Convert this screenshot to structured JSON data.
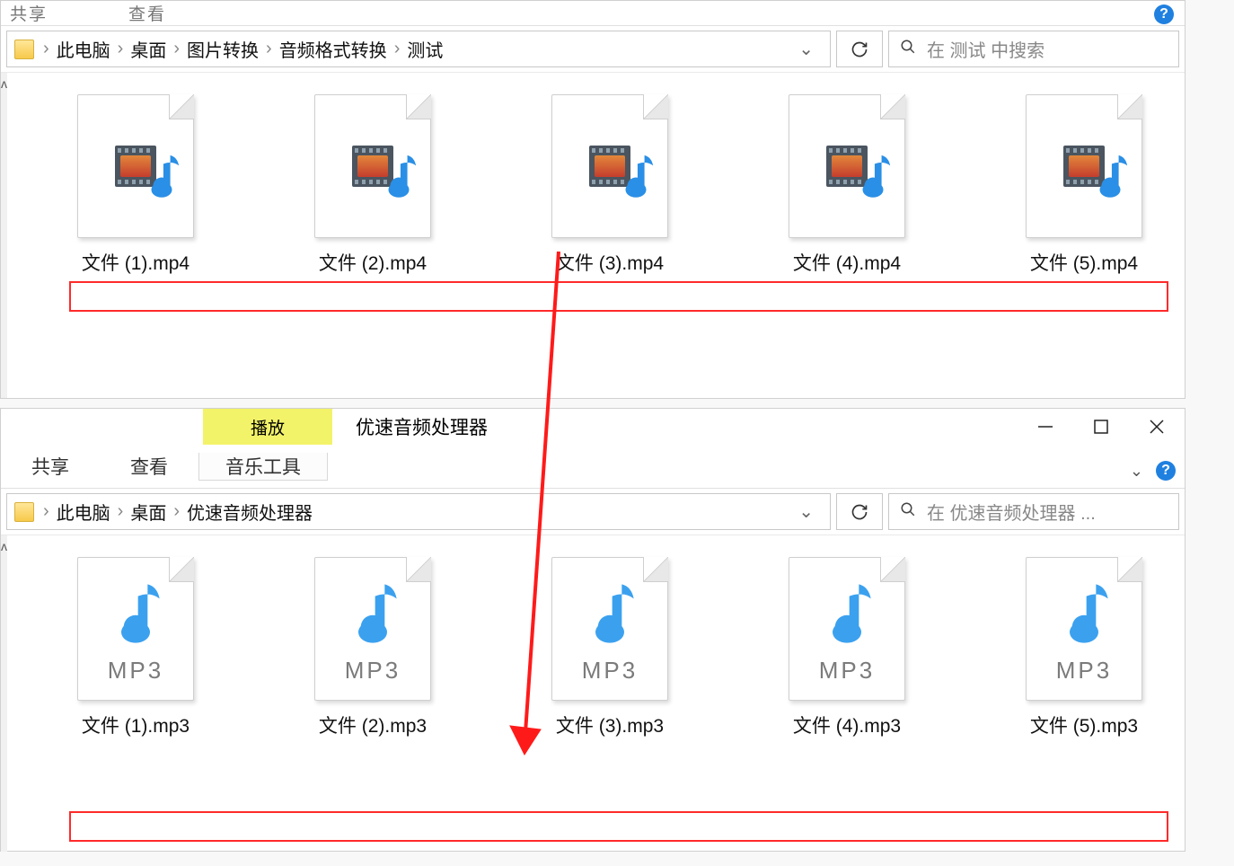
{
  "window1": {
    "ribbon_hints": [
      "共享",
      "查看"
    ],
    "breadcrumb": [
      "此电脑",
      "桌面",
      "图片转换",
      "音频格式转换",
      "测试"
    ],
    "search_placeholder": "在 测试 中搜索",
    "files": [
      {
        "name": "文件 (1).mp4"
      },
      {
        "name": "文件 (2).mp4"
      },
      {
        "name": "文件 (3).mp4"
      },
      {
        "name": "文件 (4).mp4"
      },
      {
        "name": "文件 (5).mp4"
      }
    ]
  },
  "window2": {
    "context_tab": "播放",
    "title": "优速音频处理器",
    "tabs": {
      "share": "共享",
      "view": "查看",
      "music_tools": "音乐工具"
    },
    "breadcrumb": [
      "此电脑",
      "桌面",
      "优速音频处理器"
    ],
    "search_placeholder": "在 优速音频处理器 ...",
    "mp3_label": "MP3",
    "files": [
      {
        "name": "文件 (1).mp3"
      },
      {
        "name": "文件 (2).mp3"
      },
      {
        "name": "文件 (3).mp3"
      },
      {
        "name": "文件 (4).mp3"
      },
      {
        "name": "文件 (5).mp3"
      }
    ]
  }
}
